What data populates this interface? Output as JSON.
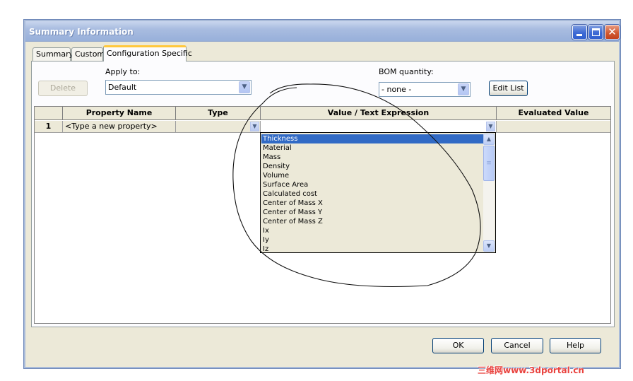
{
  "window": {
    "title": "Summary Information"
  },
  "tabs": [
    {
      "label": "Summary"
    },
    {
      "label": "Custom"
    },
    {
      "label": "Configuration Specific",
      "active": true
    }
  ],
  "form": {
    "delete_label": "Delete",
    "apply_to_label": "Apply to:",
    "apply_to_value": "Default",
    "bom_label": "BOM quantity:",
    "bom_value": "- none -",
    "edit_list_label": "Edit List"
  },
  "grid": {
    "columns": [
      "Property Name",
      "Type",
      "Value / Text Expression",
      "Evaluated Value"
    ],
    "rows": [
      {
        "number": "1",
        "property_name": "<Type a new property>",
        "type": "",
        "value": "",
        "evaluated": ""
      }
    ]
  },
  "dropdown": {
    "selected": "Thickness",
    "options": [
      "Thickness",
      "Material",
      "Mass",
      "Density",
      "Volume",
      "Surface Area",
      "Calculated cost",
      "Center of Mass X",
      "Center of Mass Y",
      "Center of Mass Z",
      "Ix",
      "Iy",
      "Iz"
    ]
  },
  "footer": {
    "ok_label": "OK",
    "cancel_label": "Cancel",
    "help_label": "Help"
  },
  "watermark": {
    "text": "三维网www.3dportal.cn"
  },
  "colors": {
    "selection": "#316ac5",
    "dialog_bg": "#ece9d8",
    "tab_highlight": "#ffc83c",
    "annotation": "#e9433f"
  },
  "icons": {
    "minimize": "minimize-icon",
    "maximize": "maximize-icon",
    "close": "close-icon",
    "dropdown": "chevron-down-icon"
  }
}
